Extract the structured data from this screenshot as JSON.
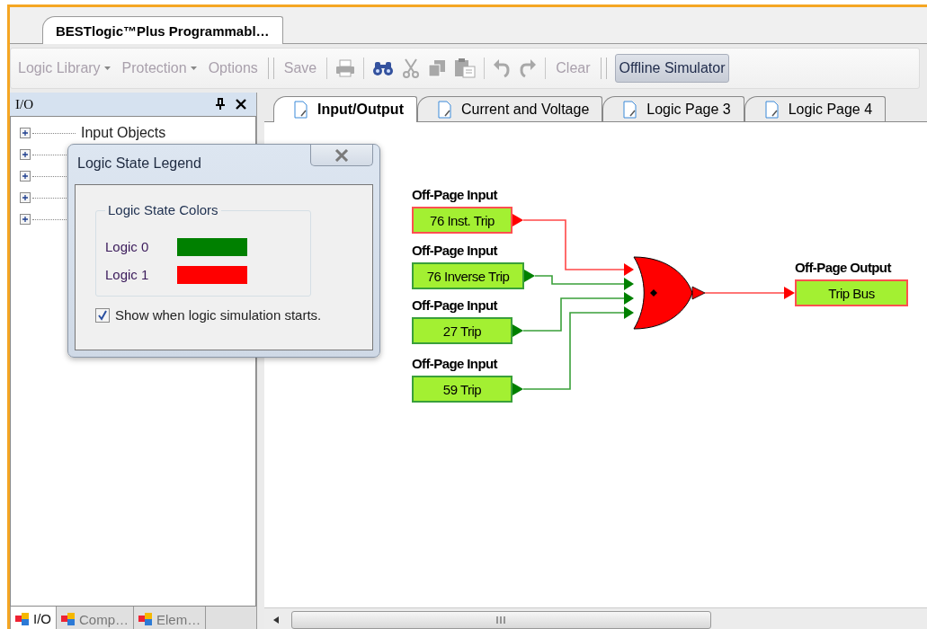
{
  "document_tabs": [
    {
      "label": "BESTlogic™Plus Programmabl…",
      "selected": true
    }
  ],
  "toolbar": [
    {
      "kind": "menu",
      "label": "Logic Library",
      "disabled": true
    },
    {
      "kind": "menu",
      "label": "Protection",
      "disabled": true
    },
    {
      "kind": "button",
      "label": "Options",
      "disabled": true
    },
    {
      "kind": "grip"
    },
    {
      "kind": "button",
      "label": "Save",
      "disabled": true
    },
    {
      "kind": "separator"
    },
    {
      "kind": "print",
      "disabled": true
    },
    {
      "kind": "separator"
    },
    {
      "kind": "find",
      "disabled": false
    },
    {
      "kind": "cut",
      "disabled": true
    },
    {
      "kind": "copy",
      "disabled": true
    },
    {
      "kind": "paste",
      "disabled": true
    },
    {
      "kind": "separator"
    },
    {
      "kind": "undo",
      "disabled": true
    },
    {
      "kind": "redo",
      "disabled": true
    },
    {
      "kind": "separator"
    },
    {
      "kind": "button",
      "label": "Clear",
      "disabled": true
    },
    {
      "kind": "grip"
    },
    {
      "kind": "toggle",
      "label": "Offline Simulator",
      "selected": true
    }
  ],
  "side_panel": {
    "title": "I/O",
    "tree": [
      {
        "label": "Input Objects",
        "expanded": false
      },
      {
        "expanded": false
      },
      {
        "expanded": false
      },
      {
        "expanded": false
      },
      {
        "expanded": false
      }
    ],
    "tabs": [
      {
        "label": "I/O",
        "selected": true
      },
      {
        "label": "Comp…",
        "selected": false
      },
      {
        "label": "Elem…",
        "selected": false
      }
    ]
  },
  "page_tabs": [
    {
      "label": "Input/Output",
      "selected": true
    },
    {
      "label": "Current and Voltage",
      "selected": false
    },
    {
      "label": "Logic Page 3",
      "selected": false
    },
    {
      "label": "Logic Page 4",
      "selected": false
    }
  ],
  "diagram": {
    "inputs": [
      {
        "header": "Off-Page Input",
        "label": "76 Inst. Trip",
        "active": true
      },
      {
        "header": "Off-Page Input",
        "label": "76 Inverse Trip",
        "active": false
      },
      {
        "header": "Off-Page Input",
        "label": "27 Trip",
        "active": false
      },
      {
        "header": "Off-Page Input",
        "label": "59 Trip",
        "active": false
      }
    ],
    "gate": {
      "active": true
    },
    "output": {
      "header": "Off-Page Output",
      "label": "Trip Bus",
      "active": true
    }
  },
  "legend_dialog": {
    "title": "Logic State Legend",
    "group_title": "Logic State Colors",
    "entries": [
      {
        "label": "Logic 0",
        "color": "#008000"
      },
      {
        "label": "Logic 1",
        "color": "#ff0000"
      }
    ],
    "checkbox": {
      "label": "Show when logic simulation starts.",
      "checked": true
    }
  }
}
